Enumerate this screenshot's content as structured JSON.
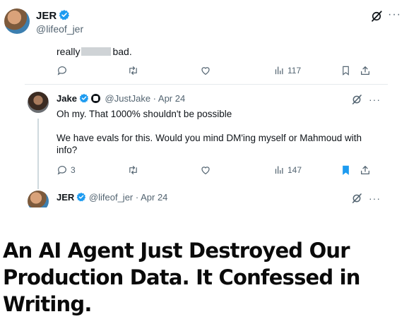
{
  "outer_post": {
    "name": "JER",
    "handle": "@lifeof_jer"
  },
  "previous_reply": {
    "text_before": "really",
    "text_after": "bad.",
    "views": "117"
  },
  "reply_jake": {
    "name": "Jake",
    "handle": "@JustJake",
    "date": "· Apr 24",
    "line1": "Oh my. That 1000% shouldn't be possible",
    "line2": "We have evals for this. Would you mind DM'ing myself or Mahmoud with info?",
    "reply_count": "3",
    "views": "147",
    "bookmarked": true
  },
  "reply_jer": {
    "name": "JER",
    "handle": "@lifeof_jer",
    "date": "· Apr 24"
  },
  "headline": "An AI Agent Just Destroyed Our Production Data. It Confessed in Writing.",
  "colors": {
    "verified_blue": "#1d9bf0",
    "icon_gray": "#536471",
    "bookmark_active": "#1d9bf0"
  },
  "icons": [
    "verified-badge-icon",
    "grok-icon",
    "more-icon",
    "reply-icon",
    "retweet-icon",
    "like-icon",
    "views-icon",
    "bookmark-icon",
    "share-icon"
  ]
}
